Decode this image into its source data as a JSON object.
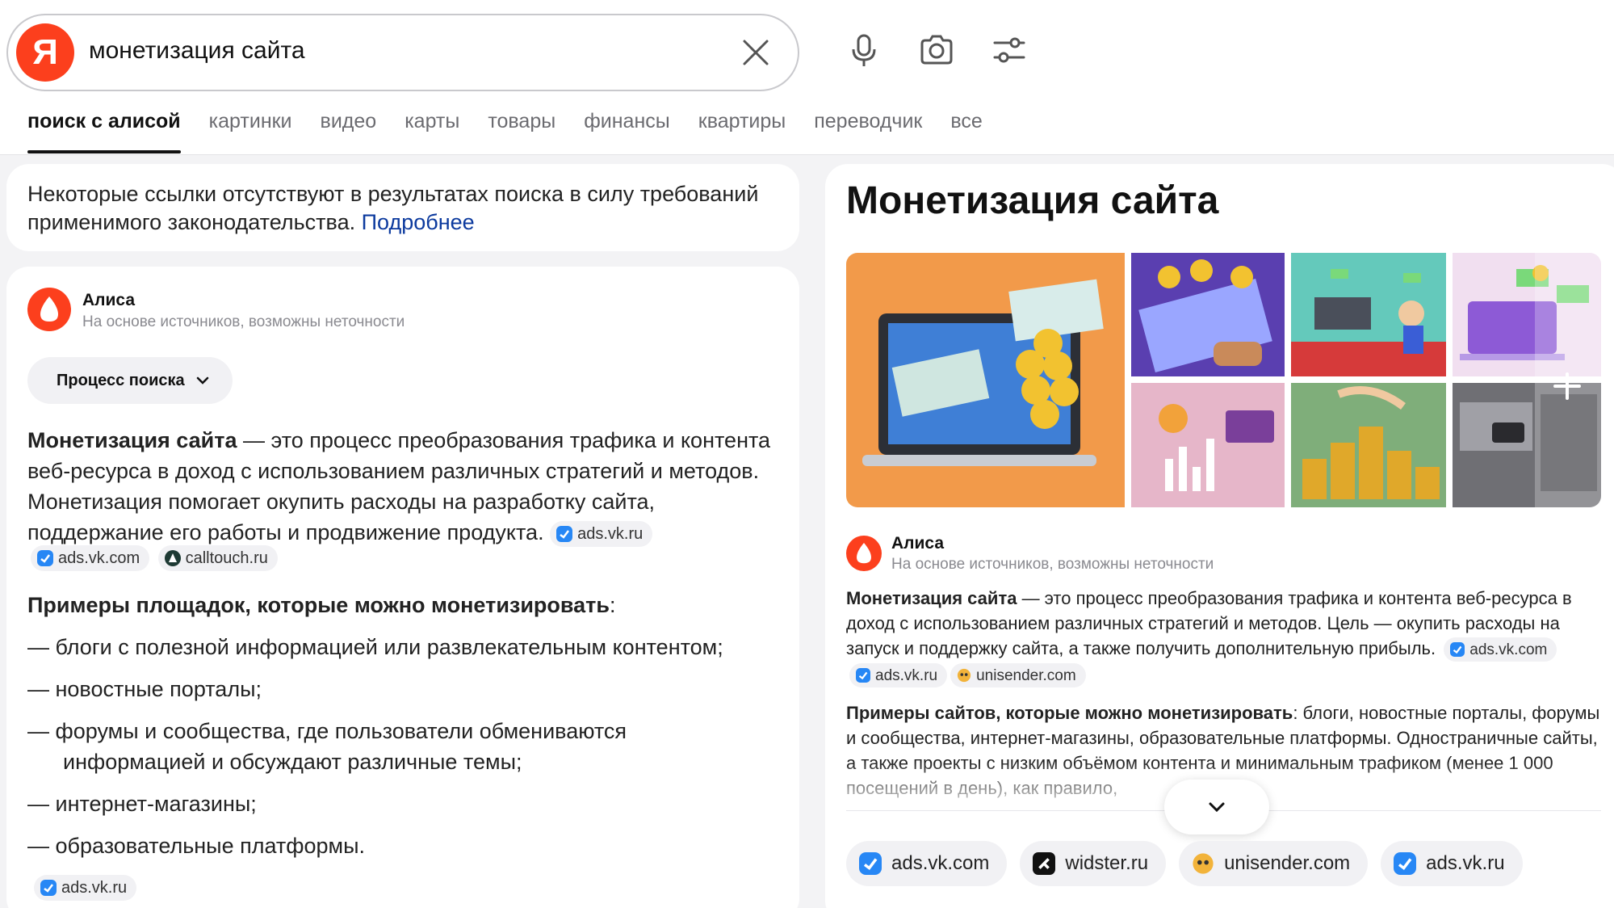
{
  "search": {
    "logo_letter": "Я",
    "query": "монетизация сайта"
  },
  "tabs": [
    {
      "label": "поиск с алисой",
      "active": true
    },
    {
      "label": "картинки"
    },
    {
      "label": "видео"
    },
    {
      "label": "карты"
    },
    {
      "label": "товары"
    },
    {
      "label": "финансы"
    },
    {
      "label": "квартиры"
    },
    {
      "label": "переводчик"
    },
    {
      "label": "все"
    }
  ],
  "notice": {
    "text": "Некоторые ссылки отсутствуют в результатах поиска в силу требований применимого законодательства. ",
    "link": "Подробнее"
  },
  "answer": {
    "alice_name": "Алиса",
    "alice_sub": "На основе источников, возможны неточности",
    "process_label": "Процесс поиска",
    "def_bold": "Монетизация сайта",
    "def_text": " — это процесс преобразования трафика и контента веб-ресурса в доход с использованием различных стратегий и методов. Монетизация помогает окупить расходы на разработку сайта, поддержание его работы и продвижение продукта. ",
    "def_sources": [
      "ads.vk.ru",
      "ads.vk.com",
      "calltouch.ru"
    ],
    "examples_bold": "Примеры площадок, которые можно монетизировать",
    "examples_colon": ":",
    "list": [
      "— блоги с полезной информацией или развлекательным контентом;",
      "— новостные порталы;",
      "— форумы и сообщества, где пользователи обмениваются",
      "информацией и обсуждают различные темы;",
      "— интернет-магазины;",
      "— образовательные платформы."
    ],
    "list_source": "ads.vk.ru"
  },
  "right": {
    "title": "Монетизация сайта",
    "alice_name": "Алиса",
    "alice_sub": "На основе источников, возможны неточности",
    "p1_bold": "Монетизация сайта",
    "p1_text": " — это процесс преобразования трафика и контента веб-ресурса в доход с использованием различных стратегий и методов. Цель — окупить расходы на запуск и поддержку сайта, а также получить дополнительную прибыль.",
    "p1_sources": [
      "ads.vk.com",
      "ads.vk.ru",
      "unisender.com"
    ],
    "p2_bold": "Примеры сайтов, которые можно монетизировать",
    "p2_text": ": блоги, новостные порталы, форумы и сообщества, интернет-магазины, образовательные платформы. Одностраничные сайты, а также проекты с низким объёмом контента и минимальным трафиком (менее 1 000 посещений в день), как правило,",
    "sources": [
      "ads.vk.com",
      "widster.ru",
      "unisender.com",
      "ads.vk.ru"
    ]
  },
  "colors": {
    "yandex_red": "#fc3f1d",
    "link_blue": "#0c3a9e",
    "vk_blue": "#2787f5"
  }
}
